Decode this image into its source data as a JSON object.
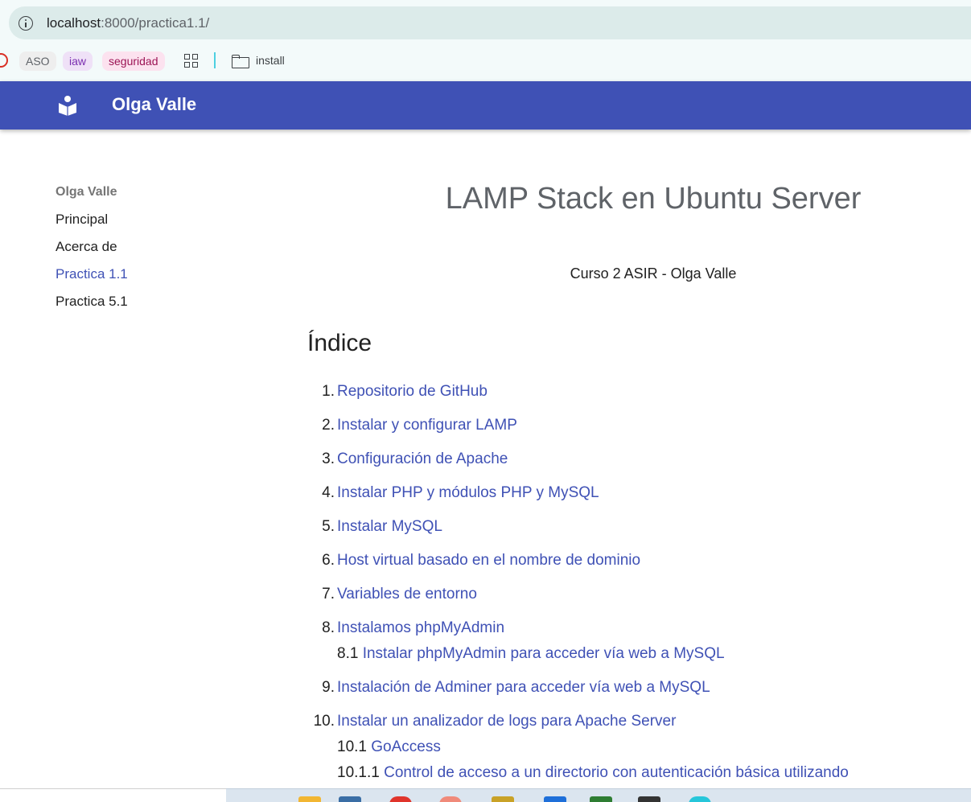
{
  "browser": {
    "url_host": "localhost",
    "url_path": ":8000/practica1.1/",
    "bookmarks": {
      "aso": "ASO",
      "iaw": "iaw",
      "seguridad": "seguridad",
      "install": "install"
    }
  },
  "header": {
    "site_title": "Olga Valle",
    "bg_color": "#3f51b5"
  },
  "sidebar": {
    "heading": "Olga Valle",
    "items": [
      {
        "label": "Principal"
      },
      {
        "label": "Acerca de"
      },
      {
        "label": "Practica 1.1",
        "active": true
      },
      {
        "label": "Practica 5.1"
      }
    ]
  },
  "main": {
    "title": "LAMP Stack en Ubuntu Server",
    "subtitle": "Curso 2 ASIR - Olga Valle",
    "index_heading": "Índice",
    "toc": [
      {
        "num": "1.",
        "label": "Repositorio de GitHub"
      },
      {
        "num": "2.",
        "label": "Instalar y configurar LAMP"
      },
      {
        "num": "3.",
        "label": "Configuración de Apache"
      },
      {
        "num": "4.",
        "label": "Instalar PHP y módulos PHP y MySQL"
      },
      {
        "num": "5.",
        "label": "Instalar MySQL"
      },
      {
        "num": "6.",
        "label": "Host virtual basado en el nombre de dominio"
      },
      {
        "num": "7.",
        "label": "Variables de entorno"
      },
      {
        "num": "8.",
        "label": "Instalamos phpMyAdmin"
      },
      {
        "num": "9.",
        "label": "Instalación de Adminer para acceder vía web a MySQL"
      },
      {
        "num": "10.",
        "label": "Instalar un analizador de logs para Apache Server"
      }
    ],
    "toc_sub": [
      {
        "num": "8.1",
        "label": "Instalar phpMyAdmin para acceder vía web a MySQL"
      },
      {
        "num": "10.1",
        "label": "GoAccess"
      },
      {
        "num": "10.1.1",
        "label": "Control de acceso a un directorio con autenticación básica utilizando"
      }
    ]
  },
  "colors": {
    "link": "#3f51b5",
    "text": "#212121"
  }
}
